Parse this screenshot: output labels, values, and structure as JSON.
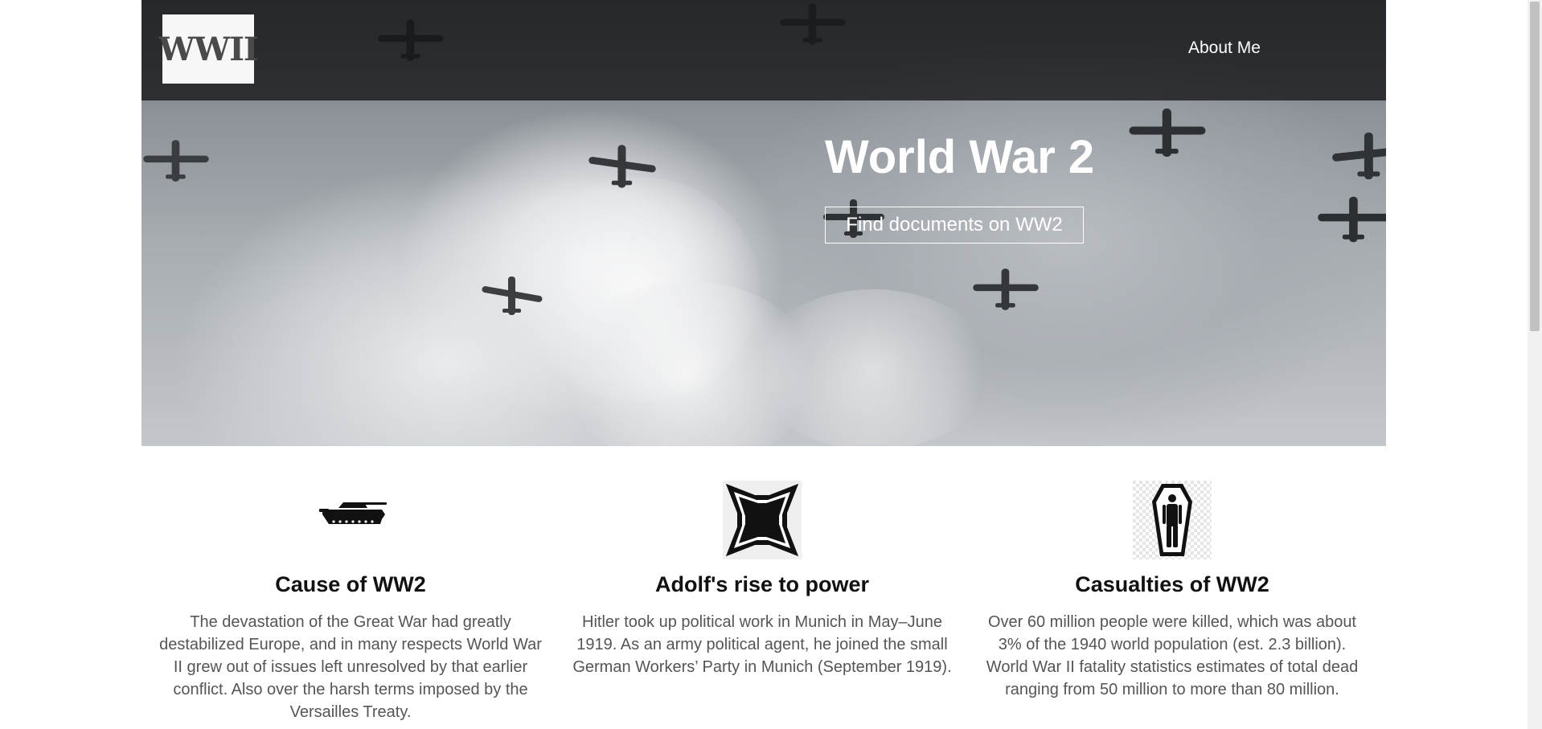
{
  "header": {
    "logo_text": "WWII",
    "nav_about": "About Me"
  },
  "hero": {
    "title": "World War 2",
    "button_label": "Find documents on WW2"
  },
  "features": [
    {
      "icon": "tank-icon",
      "title": "Cause of WW2",
      "text": "The devastation of the Great War had greatly destabilized Europe, and in many respects World War II grew out of issues left unresolved by that earlier conflict. Also over the harsh terms imposed by the Versailles Treaty."
    },
    {
      "icon": "iron-cross-icon",
      "title": "Adolf's rise to power",
      "text": "Hitler took up political work in Munich in May–June 1919. As an army political agent, he joined the small German Workers’ Party in Munich (September 1919)."
    },
    {
      "icon": "coffin-icon",
      "title": "Casualties of WW2",
      "text": "Over 60 million people were killed, which was about 3% of the 1940 world population (est. 2.3 billion). World War II fatality statistics estimates of total dead ranging from 50 million to more than 80 million."
    }
  ],
  "colors": {
    "topbar": "#1a1b1d",
    "hero_text": "#ffffff",
    "body_text": "#555555",
    "heading": "#111111"
  }
}
